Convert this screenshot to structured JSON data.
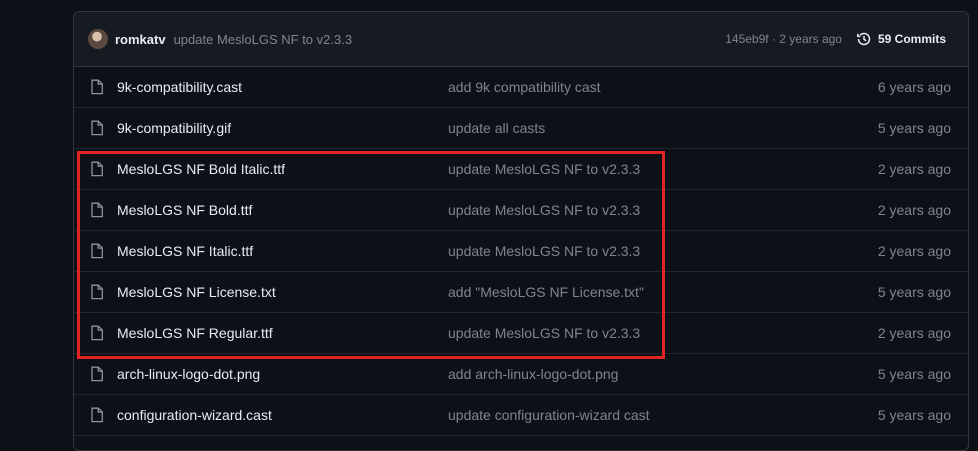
{
  "header": {
    "author": "romkatv",
    "message": "update MesloLGS NF to v2.3.3",
    "sha_time": "145eb9f · 2 years ago",
    "commits": "59 Commits"
  },
  "files": [
    {
      "name": "9k-compatibility.cast",
      "message": "add 9k compatibility cast",
      "age": "6 years ago"
    },
    {
      "name": "9k-compatibility.gif",
      "message": "update all casts",
      "age": "5 years ago"
    },
    {
      "name": "MesloLGS NF Bold Italic.ttf",
      "message": "update MesloLGS NF to v2.3.3",
      "age": "2 years ago"
    },
    {
      "name": "MesloLGS NF Bold.ttf",
      "message": "update MesloLGS NF to v2.3.3",
      "age": "2 years ago"
    },
    {
      "name": "MesloLGS NF Italic.ttf",
      "message": "update MesloLGS NF to v2.3.3",
      "age": "2 years ago"
    },
    {
      "name": "MesloLGS NF License.txt",
      "message": "add \"MesloLGS NF License.txt\"",
      "age": "5 years ago"
    },
    {
      "name": "MesloLGS NF Regular.ttf",
      "message": "update MesloLGS NF to v2.3.3",
      "age": "2 years ago"
    },
    {
      "name": "arch-linux-logo-dot.png",
      "message": "add arch-linux-logo-dot.png",
      "age": "5 years ago"
    },
    {
      "name": "configuration-wizard.cast",
      "message": "update configuration-wizard cast",
      "age": "5 years ago"
    }
  ],
  "colors": {
    "highlight": "#e02424",
    "background": "#0d1117"
  },
  "icons": {
    "file": "file-icon",
    "history": "history-icon"
  }
}
